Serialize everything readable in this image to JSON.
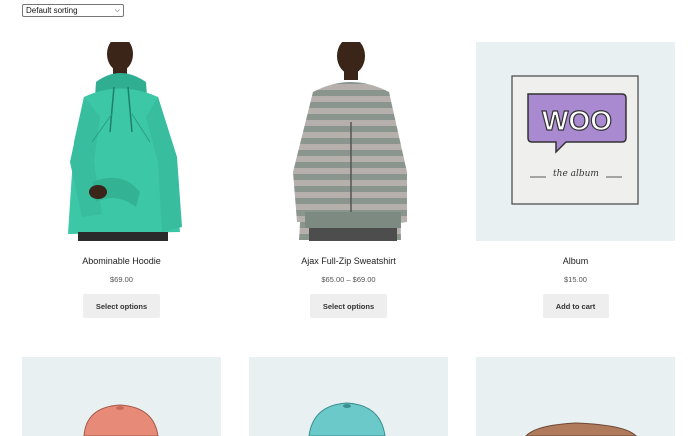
{
  "sorting": {
    "selected": "Default sorting"
  },
  "products": [
    {
      "title": "Abominable Hoodie",
      "price": "$69.00",
      "button": "Select options",
      "image": "teal-hoodie"
    },
    {
      "title": "Ajax Full-Zip Sweatshirt",
      "price": "$65.00 – $69.00",
      "button": "Select options",
      "image": "striped-zip-hoodie"
    },
    {
      "title": "Album",
      "price": "$15.00",
      "button": "Add to cart",
      "image": "woo-album-cover"
    }
  ],
  "album_art": {
    "logo_text": "WOO",
    "caption": "the album"
  },
  "next_row_images": [
    "red-cap",
    "blue-cap",
    "brown-hat"
  ],
  "colors": {
    "hoodie_teal": "#3cc7a6",
    "stripe_gray": "#7a8a80",
    "woo_purple": "#a98ad0",
    "image_bg": "#e8f0f2",
    "button_bg": "#eeeeee"
  }
}
